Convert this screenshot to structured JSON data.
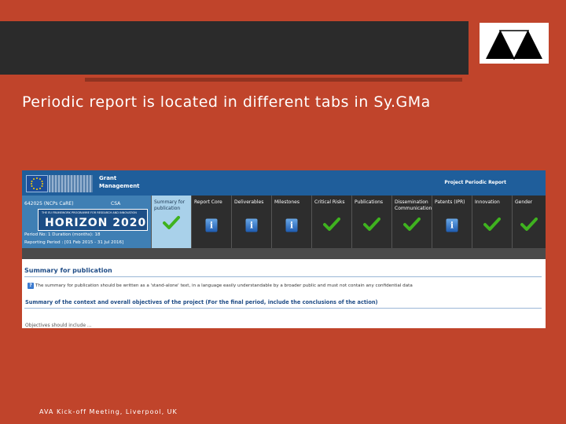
{
  "slide": {
    "title": "Periodic report is located in different tabs in Sy.GMa",
    "footer": "AVA Kick-off Meeting, Liverpool, UK"
  },
  "screenshot": {
    "brand": {
      "line1": "Grant",
      "line2": "Management"
    },
    "header_title": "Project Periodic Report",
    "project": {
      "id": "642025 (NCPs CaRE)",
      "type": "CSA",
      "programme_tag": "THE EU FRAMEWORK PROGRAMME FOR RESEARCH AND INNOVATION",
      "programme_name": "HORIZON 2020",
      "period_line": "Period No: 1        Duration (months): 18",
      "reporting_line": "Reporting Period : [01 Feb 2015 - 31 Jul 2016]"
    },
    "tabs": [
      {
        "label": "Summary for publication",
        "icon": "check-icon",
        "active": true
      },
      {
        "label": "Report Core",
        "icon": "info-icon",
        "active": false
      },
      {
        "label": "Deliverables",
        "icon": "info-icon",
        "active": false
      },
      {
        "label": "Milestones",
        "icon": "info-icon",
        "active": false
      },
      {
        "label": "Critical Risks",
        "icon": "check-icon",
        "active": false
      },
      {
        "label": "Publications",
        "icon": "check-icon",
        "active": false
      },
      {
        "label": "Dissemination Communication",
        "icon": "check-icon",
        "active": false
      },
      {
        "label": "Patents (IPR)",
        "icon": "info-icon",
        "active": false
      },
      {
        "label": "Innovation",
        "icon": "check-icon",
        "active": false
      },
      {
        "label": "Gender",
        "icon": "check-icon",
        "active": false
      }
    ],
    "section_heading": "Summary for publication",
    "note_icon_glyph": "?",
    "note_text": "The summary for publication should be written as a 'stand-alone' text, in a language easily understandable by a broader public and must not contain any confidential data",
    "context_heading": "Summary of the context and overall objectives of the project (For the final period, include the conclusions of the action)",
    "cutoff_text": "Objectives should include ..."
  },
  "colors": {
    "background": "#c0442b",
    "topbar": "#2b2b2b",
    "brand_blue": "#1f5e9b",
    "active_tab": "#a9d1ea",
    "check_green": "#3fb21f"
  }
}
